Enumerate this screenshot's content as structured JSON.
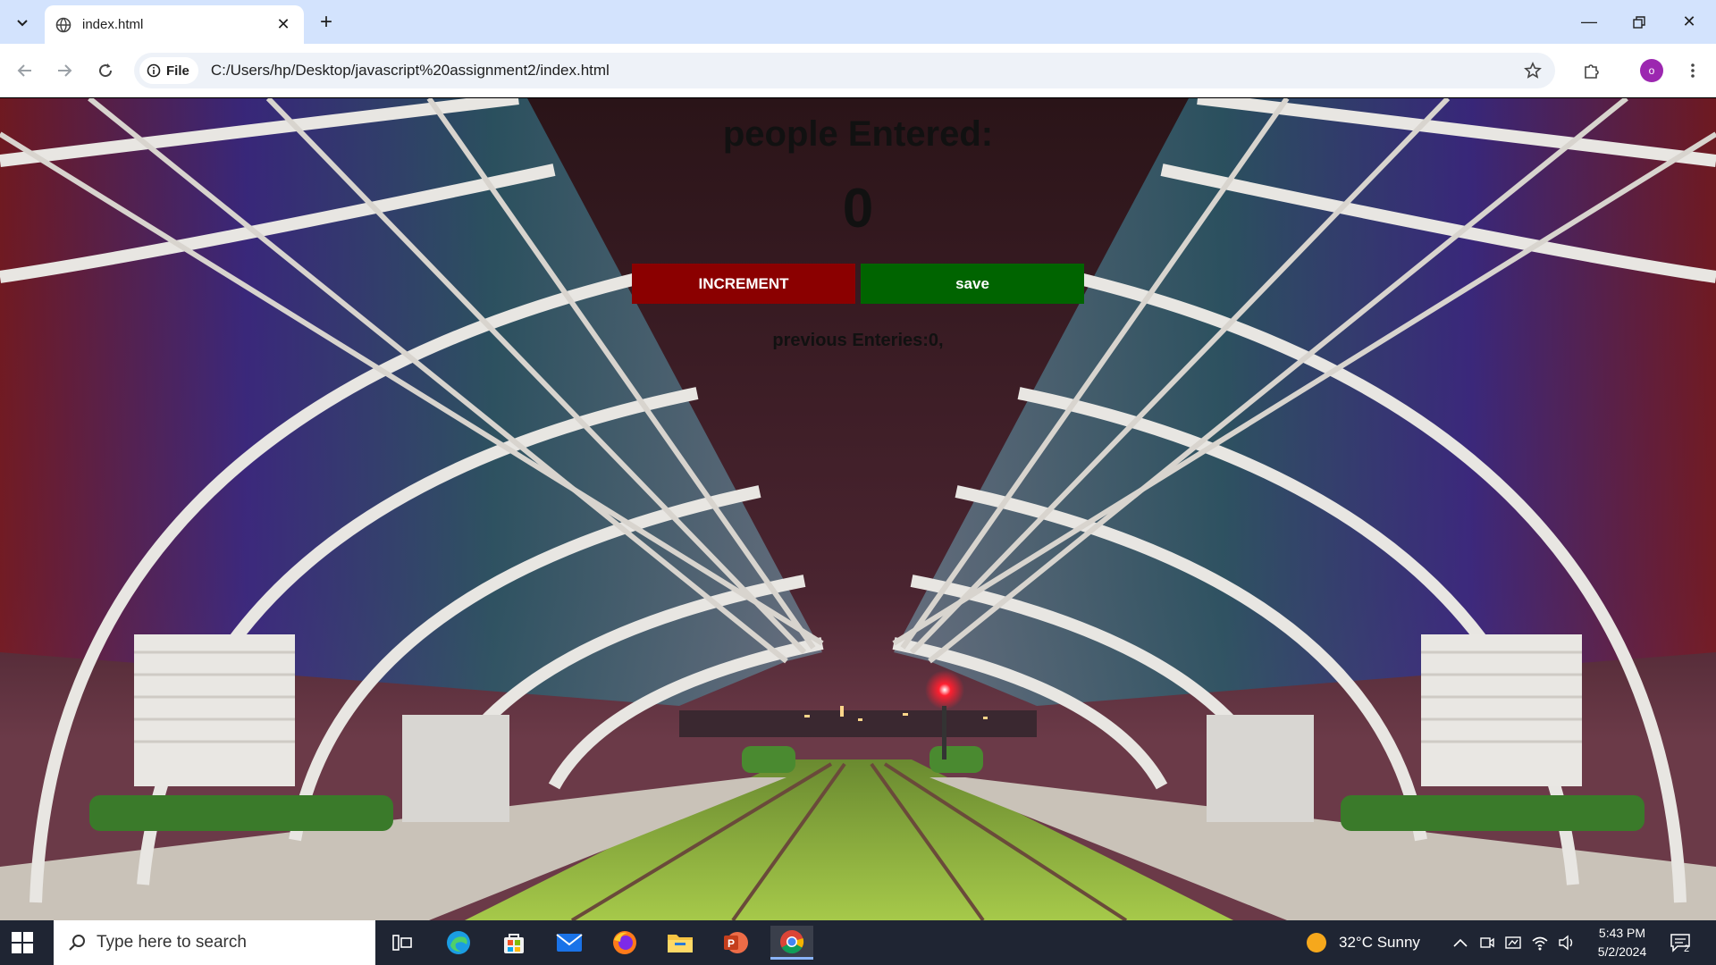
{
  "browser": {
    "tab_title": "index.html",
    "site_chip": "File",
    "url": "C:/Users/hp/Desktop/javascript%20assignment2/index.html",
    "profile_initial": "o"
  },
  "page": {
    "heading": "people Entered:",
    "count": "0",
    "increment_label": "INCREMENT",
    "save_label": "save",
    "previous_entries": "previous Enteries:0,"
  },
  "taskbar": {
    "search_placeholder": "Type here to search",
    "weather": "32°C  Sunny",
    "time": "5:43 PM",
    "date": "5/2/2024",
    "notification_count": "2"
  }
}
